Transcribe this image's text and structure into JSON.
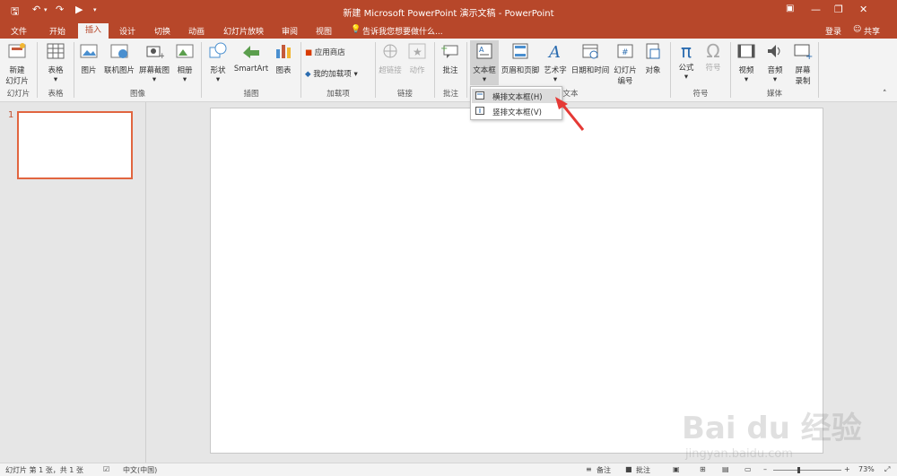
{
  "titlebar": {
    "title": "新建 Microsoft PowerPoint 演示文稿 - PowerPoint",
    "login": "登录",
    "share": "共享",
    "bg_color": "#b7472a"
  },
  "tabs": [
    "文件",
    "开始",
    "插入",
    "设计",
    "切换",
    "动画",
    "幻灯片放映",
    "审阅",
    "视图"
  ],
  "active_tab": "插入",
  "tell_me": "告诉我您想要做什么...",
  "ribbon": {
    "new_slide": [
      "新建",
      "幻灯片"
    ],
    "table": "表格",
    "images": [
      "图片",
      "联机图片",
      "屏幕截图",
      "相册"
    ],
    "shapes": "形状",
    "smartart": "SmartArt",
    "chart": "图表",
    "store": "应用商店",
    "my_addins": "我的加载项",
    "hyperlink": "超链接",
    "action": "动作",
    "comment": "批注",
    "textbox": "文本框",
    "header_footer": "页眉和页脚",
    "wordart": "艺术字",
    "datetime": "日期和时间",
    "slide_number": [
      "幻灯片",
      "编号"
    ],
    "object": "对象",
    "equation": "公式",
    "symbol": "符号",
    "video": "视频",
    "audio": "音频",
    "screen_record": [
      "屏幕",
      "录制"
    ],
    "groups": [
      "幻灯片",
      "表格",
      "图像",
      "插图",
      "加载项",
      "链接",
      "批注",
      "文本",
      "符号",
      "媒体"
    ]
  },
  "dropdown": {
    "items": [
      "横排文本框(H)",
      "竖排文本框(V)"
    ]
  },
  "thumbnail": {
    "number": "1",
    "border_color": "#e1653f"
  },
  "status": {
    "slide_info": "幻灯片 第 1 张，共 1 张",
    "language": "中文(中国)",
    "notes": "备注",
    "comments": "批注",
    "zoom": "73%",
    "zoom_level": 0.73
  },
  "watermark": {
    "brand": "Bai du 经验",
    "url": "jingyan.baidu.com"
  }
}
